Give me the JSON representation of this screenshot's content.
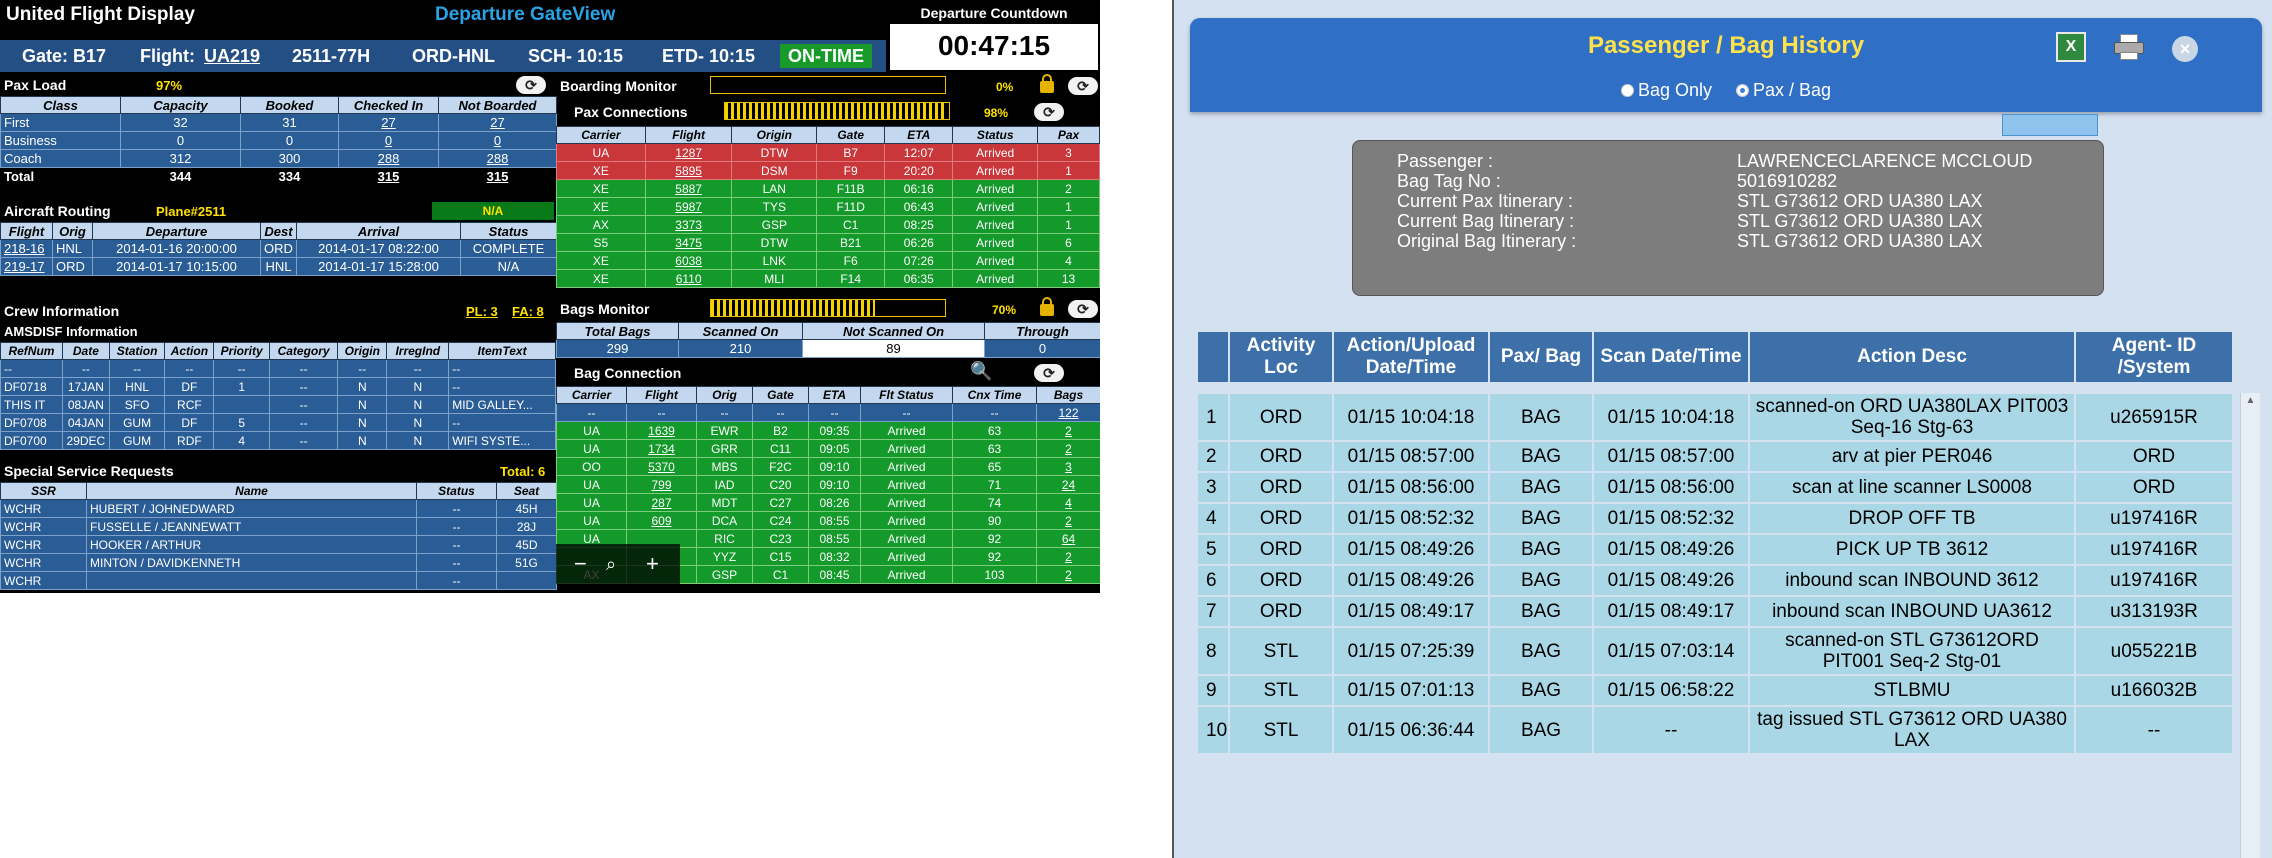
{
  "dashboard": {
    "title": "United Flight Display",
    "view_title": "Departure GateView",
    "countdown_label": "Departure Countdown",
    "countdown": "00:47:15",
    "gate": "Gate: B17",
    "flight_label": "Flight:",
    "flight": "UA219",
    "aircraft": "2511-77H",
    "route": "ORD-HNL",
    "sch": "SCH- 10:15",
    "etd": "ETD- 10:15",
    "status": "ON-TIME",
    "pax_load": {
      "title": "Pax Load",
      "percent": "97%",
      "headers": [
        "Class",
        "Capacity",
        "Booked",
        "Checked In",
        "Not Boarded"
      ],
      "rows": [
        [
          "First",
          "32",
          "31",
          "27",
          "27"
        ],
        [
          "Business",
          "0",
          "0",
          "0",
          "0"
        ],
        [
          "Coach",
          "312",
          "300",
          "288",
          "288"
        ],
        [
          "Total",
          "344",
          "334",
          "315",
          "315"
        ]
      ]
    },
    "routing": {
      "title": "Aircraft Routing",
      "plane": "Plane#2511",
      "status_na": "N/A",
      "headers": [
        "Flight",
        "Orig",
        "Departure",
        "Dest",
        "Arrival",
        "Status"
      ],
      "rows": [
        [
          "218-16",
          "HNL",
          "2014-01-16 20:00:00",
          "ORD",
          "2014-01-17 08:22:00",
          "COMPLETE"
        ],
        [
          "219-17",
          "ORD",
          "2014-01-17 10:15:00",
          "HNL",
          "2014-01-17 15:28:00",
          "N/A"
        ]
      ]
    },
    "crew": {
      "title": "Crew Information",
      "pl": "PL: 3",
      "fa": "FA: 8",
      "amsdisf_title": "AMSDISF Information",
      "headers": [
        "RefNum",
        "Date",
        "Station",
        "Action",
        "Priority",
        "Category",
        "Origin",
        "IrregInd",
        "ItemText"
      ],
      "rows": [
        [
          "--",
          "--",
          "--",
          "--",
          "--",
          "--",
          "--",
          "--",
          "--"
        ],
        [
          "DF0718",
          "17JAN",
          "HNL",
          "DF",
          "1",
          "--",
          "N",
          "N",
          "--"
        ],
        [
          "THIS IT",
          "08JAN",
          "SFO",
          "RCF",
          "",
          "--",
          "N",
          "N",
          "MID GALLEY..."
        ],
        [
          "DF0708",
          "04JAN",
          "GUM",
          "DF",
          "5",
          "--",
          "N",
          "N",
          "--"
        ],
        [
          "DF0700",
          "29DEC",
          "GUM",
          "RDF",
          "4",
          "--",
          "N",
          "N",
          "WIFI SYSTE..."
        ]
      ]
    },
    "ssr": {
      "title": "Special Service Requests",
      "total": "Total: 6",
      "headers": [
        "SSR",
        "Name",
        "Status",
        "Seat"
      ],
      "rows": [
        [
          "WCHR",
          "HUBERT / JOHNEDWARD",
          "--",
          "45H"
        ],
        [
          "WCHR",
          "FUSSELLE / JEANNEWATT",
          "--",
          "28J"
        ],
        [
          "WCHR",
          "HOOKER / ARTHUR",
          "--",
          "45D"
        ],
        [
          "WCHR",
          "MINTON / DAVIDKENNETH",
          "--",
          "51G"
        ],
        [
          "WCHR",
          "",
          "--",
          ""
        ]
      ]
    },
    "boarding": {
      "title": "Boarding Monitor",
      "percent": "0%",
      "fill": 0
    },
    "pax_conn": {
      "title": "Pax Connections",
      "percent": "98%",
      "fill": 0.98,
      "headers": [
        "Carrier",
        "Flight",
        "Origin",
        "Gate",
        "ETA",
        "Status",
        "Pax"
      ],
      "rows": [
        [
          "UA",
          "1287",
          "DTW",
          "B7",
          "12:07",
          "Arrived",
          "3",
          "red"
        ],
        [
          "XE",
          "5895",
          "DSM",
          "F9",
          "20:20",
          "Arrived",
          "1",
          "red"
        ],
        [
          "XE",
          "5887",
          "LAN",
          "F11B",
          "06:16",
          "Arrived",
          "2",
          "green"
        ],
        [
          "XE",
          "5987",
          "TYS",
          "F11D",
          "06:43",
          "Arrived",
          "1",
          "green"
        ],
        [
          "AX",
          "3373",
          "GSP",
          "C1",
          "08:25",
          "Arrived",
          "1",
          "green"
        ],
        [
          "S5",
          "3475",
          "DTW",
          "B21",
          "06:26",
          "Arrived",
          "6",
          "green"
        ],
        [
          "XE",
          "6038",
          "LNK",
          "F6",
          "07:26",
          "Arrived",
          "4",
          "green"
        ],
        [
          "XE",
          "6110",
          "MLI",
          "F14",
          "06:35",
          "Arrived",
          "13",
          "green"
        ]
      ]
    },
    "bags_monitor": {
      "title": "Bags Monitor",
      "percent": "70%",
      "fill": 0.7,
      "headers": [
        "Total Bags",
        "Scanned On",
        "Not Scanned On",
        "Through"
      ],
      "values": [
        "299",
        "210",
        "89",
        "0"
      ]
    },
    "bag_conn": {
      "title": "Bag Connection",
      "headers": [
        "Carrier",
        "Flight",
        "Orig",
        "Gate",
        "ETA",
        "Flt Status",
        "Cnx Time",
        "Bags"
      ],
      "rows": [
        [
          "--",
          "--",
          "--",
          "--",
          "--",
          "--",
          "--",
          "122"
        ],
        [
          "UA",
          "1639",
          "EWR",
          "B2",
          "09:35",
          "Arrived",
          "63",
          "2"
        ],
        [
          "UA",
          "1734",
          "GRR",
          "C11",
          "09:05",
          "Arrived",
          "63",
          "2"
        ],
        [
          "OO",
          "5370",
          "MBS",
          "F2C",
          "09:10",
          "Arrived",
          "65",
          "3"
        ],
        [
          "UA",
          "799",
          "IAD",
          "C20",
          "09:10",
          "Arrived",
          "71",
          "24"
        ],
        [
          "UA",
          "287",
          "MDT",
          "C27",
          "08:26",
          "Arrived",
          "74",
          "4"
        ],
        [
          "UA",
          "609",
          "DCA",
          "C24",
          "08:55",
          "Arrived",
          "90",
          "2"
        ],
        [
          "UA",
          "",
          "RIC",
          "C23",
          "08:55",
          "Arrived",
          "92",
          "64"
        ],
        [
          "",
          "",
          "YYZ",
          "C15",
          "08:32",
          "Arrived",
          "92",
          "2"
        ],
        [
          "AX",
          "",
          "GSP",
          "C1",
          "08:45",
          "Arrived",
          "103",
          "2"
        ]
      ]
    }
  },
  "history": {
    "title": "Passenger / Bag History",
    "radio_bag": "Bag Only",
    "radio_pax": "Pax / Bag",
    "info": [
      {
        "label": "Passenger  :",
        "value": "LAWRENCECLARENCE MCCLOUD"
      },
      {
        "label": "Bag Tag No  :",
        "value": "5016910282"
      },
      {
        "label": "Current Pax Itinerary  :",
        "value": "STL G73612 ORD UA380 LAX"
      },
      {
        "label": "Current Bag Itinerary  :",
        "value": "STL G73612 ORD UA380 LAX"
      },
      {
        "label": "Original Bag Itinerary  :",
        "value": "STL G73612 ORD UA380 LAX"
      }
    ],
    "headers": [
      "",
      "Activity Loc",
      "Action/Upload Date/Time",
      "Pax/ Bag",
      "Scan Date/Time",
      "Action Desc",
      "Agent- ID /System"
    ],
    "rows": [
      [
        "1",
        "ORD",
        "01/15 10:04:18",
        "BAG",
        "01/15 10:04:18",
        "scanned-on ORD UA380LAX PIT003 Seq-16 Stg-63",
        "u265915R"
      ],
      [
        "2",
        "ORD",
        "01/15 08:57:00",
        "BAG",
        "01/15 08:57:00",
        "arv at pier PER046",
        "ORD"
      ],
      [
        "3",
        "ORD",
        "01/15 08:56:00",
        "BAG",
        "01/15 08:56:00",
        "scan at line scanner LS0008",
        "ORD"
      ],
      [
        "4",
        "ORD",
        "01/15 08:52:32",
        "BAG",
        "01/15 08:52:32",
        "DROP OFF TB",
        "u197416R"
      ],
      [
        "5",
        "ORD",
        "01/15 08:49:26",
        "BAG",
        "01/15 08:49:26",
        "PICK UP TB 3612",
        "u197416R"
      ],
      [
        "6",
        "ORD",
        "01/15 08:49:26",
        "BAG",
        "01/15 08:49:26",
        "inbound scan INBOUND 3612",
        "u197416R"
      ],
      [
        "7",
        "ORD",
        "01/15 08:49:17",
        "BAG",
        "01/15 08:49:17",
        "inbound scan INBOUND UA3612",
        "u313193R"
      ],
      [
        "8",
        "STL",
        "01/15 07:25:39",
        "BAG",
        "01/15 07:03:14",
        "scanned-on STL G73612ORD PIT001 Seq-2 Stg-01",
        "u055221B"
      ],
      [
        "9",
        "STL",
        "01/15 07:01:13",
        "BAG",
        "01/15 06:58:22",
        "STLBMU",
        "u166032B"
      ],
      [
        "10",
        "STL",
        "01/15 06:36:44",
        "BAG",
        "--",
        "tag issued STL G73612 ORD UA380 LAX",
        "--"
      ]
    ]
  }
}
